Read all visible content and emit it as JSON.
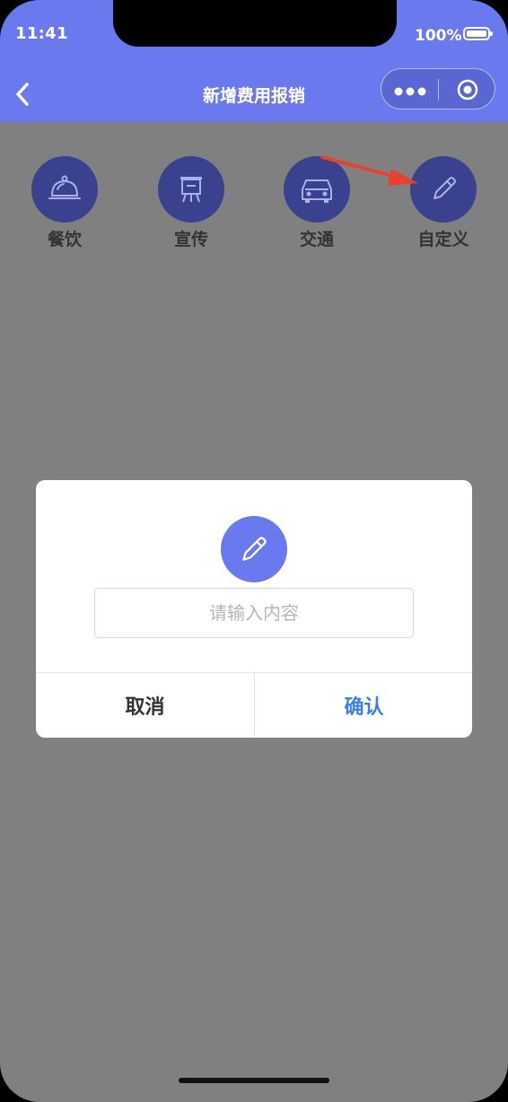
{
  "status_bar": {
    "time": "11:41",
    "battery": "100%"
  },
  "nav": {
    "title": "新增费用报销"
  },
  "categories": [
    {
      "label": "餐饮",
      "icon": "dining-cloche-icon"
    },
    {
      "label": "宣传",
      "icon": "presentation-board-icon"
    },
    {
      "label": "交通",
      "icon": "car-icon"
    },
    {
      "label": "自定义",
      "icon": "pencil-icon"
    }
  ],
  "dialog": {
    "icon": "pencil-icon",
    "input_placeholder": "请输入内容",
    "input_value": "",
    "cancel_label": "取消",
    "confirm_label": "确认"
  },
  "colors": {
    "header": "#6b79ee",
    "overlay": "#808080",
    "category_circle": "#3a418f",
    "confirm_text": "#3b7ee8",
    "annotation_arrow": "#e8412f"
  }
}
